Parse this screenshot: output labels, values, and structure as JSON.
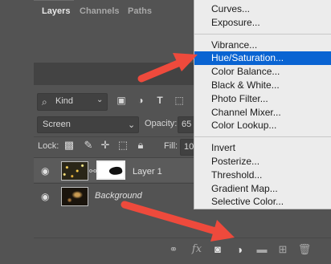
{
  "tabs": [
    {
      "label": "Layers",
      "active": true
    },
    {
      "label": "Channels",
      "active": false
    },
    {
      "label": "Paths",
      "active": false
    }
  ],
  "filter": {
    "kind_label": "Kind",
    "icons": [
      "image-filter-icon",
      "adjustment-filter-icon",
      "type-filter-icon",
      "shape-filter-icon"
    ]
  },
  "blend": {
    "mode": "Screen",
    "opacity_label": "Opacity:",
    "opacity_value": "65"
  },
  "lock": {
    "label": "Lock:",
    "fill_label": "Fill:",
    "fill_value": "10"
  },
  "layers": [
    {
      "name": "Layer 1",
      "selected": true
    },
    {
      "name": "Background",
      "selected": false
    }
  ],
  "menu": {
    "groups": [
      [
        "Curves...",
        "Exposure..."
      ],
      [
        "Vibrance...",
        "Hue/Saturation...",
        "Color Balance...",
        "Black & White...",
        "Photo Filter...",
        "Channel Mixer...",
        "Color Lookup..."
      ],
      [
        "Invert",
        "Posterize...",
        "Threshold...",
        "Gradient Map...",
        "Selective Color..."
      ]
    ],
    "highlighted": "Hue/Saturation...",
    "highlight_color": "#0a64d2"
  },
  "footer": {
    "fx_label": "fx"
  },
  "colors": {
    "arrow": "#ee4a3c",
    "panel": "#535353",
    "menu_bg": "#ececec"
  }
}
